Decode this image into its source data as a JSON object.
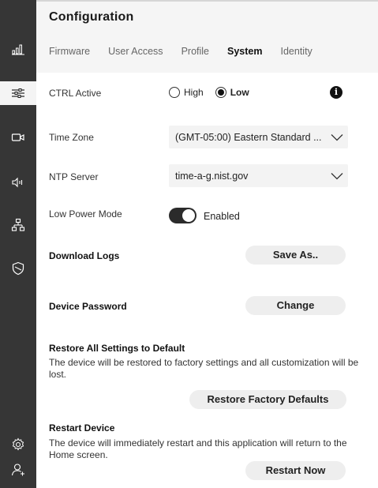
{
  "title": "Configuration",
  "tabs": [
    {
      "label": "Firmware"
    },
    {
      "label": "User Access"
    },
    {
      "label": "Profile"
    },
    {
      "label": "System",
      "active": true
    },
    {
      "label": "Identity"
    }
  ],
  "sidebar": {
    "items": [
      {
        "icon": "bar-chart-icon"
      },
      {
        "icon": "sliders-icon",
        "active": true
      },
      {
        "icon": "camera-icon"
      },
      {
        "icon": "speaker-icon"
      },
      {
        "icon": "network-icon"
      },
      {
        "icon": "shield-icon"
      },
      {
        "icon": "gear-icon"
      },
      {
        "icon": "user-icon"
      }
    ]
  },
  "ctrl_active": {
    "label": "CTRL Active",
    "options": [
      "High",
      "Low"
    ],
    "selected": "Low",
    "info_icon": "info-icon"
  },
  "time_zone": {
    "label": "Time Zone",
    "value": "(GMT-05:00) Eastern Standard ..."
  },
  "ntp_server": {
    "label": "NTP Server",
    "value": "time-a-g.nist.gov"
  },
  "low_power": {
    "label": "Low Power Mode",
    "state": "Enabled",
    "on": true
  },
  "download_logs": {
    "label": "Download Logs",
    "button": "Save As.."
  },
  "device_password": {
    "label": "Device Password",
    "button": "Change"
  },
  "restore": {
    "label": "Restore All Settings to Default",
    "description": "The device will be restored to factory settings and all customization will be lost.",
    "button": "Restore Factory Defaults"
  },
  "restart": {
    "label": "Restart Device",
    "description": "The device will immediately restart and this application will return to the Home screen.",
    "button": "Restart Now"
  },
  "colors": {
    "sidebar": "#363636",
    "header_bg": "#f5f5f5",
    "button_bg": "#eeeeee",
    "toggle_on": "#2b2b2b"
  }
}
